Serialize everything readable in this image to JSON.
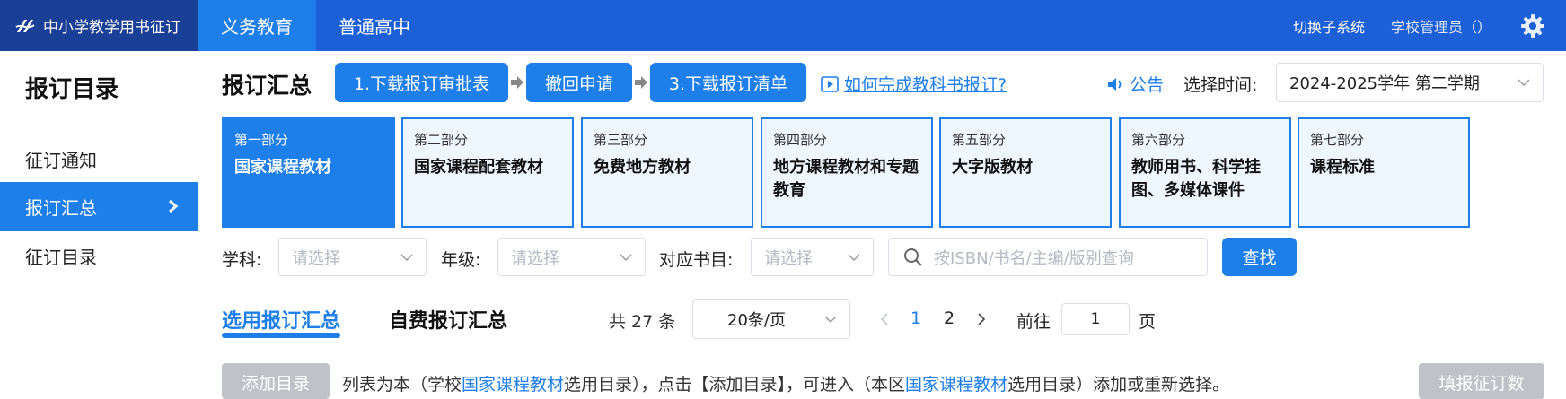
{
  "app": {
    "title": "中小学教学用书征订"
  },
  "nav": {
    "tabs": [
      {
        "label": "义务教育"
      },
      {
        "label": "普通高中"
      }
    ]
  },
  "topbar": {
    "switch_label": "切换子系统",
    "user_label": "学校管理员（）"
  },
  "sidebar": {
    "title": "报订目录",
    "items": [
      {
        "label": "征订通知"
      },
      {
        "label": "报订汇总"
      },
      {
        "label": "征订目录"
      }
    ]
  },
  "header": {
    "title": "报订汇总",
    "steps": [
      {
        "label": "1.下载报订审批表"
      },
      {
        "label": "撤回申请"
      },
      {
        "label": "3.下载报订清单"
      }
    ],
    "help_link": "如何完成教科书报订?",
    "notice": "公告",
    "time_label": "选择时间:",
    "time_value": "2024-2025学年 第二学期"
  },
  "parts": [
    {
      "no": "第一部分",
      "name": "国家课程教材"
    },
    {
      "no": "第二部分",
      "name": "国家课程配套教材"
    },
    {
      "no": "第三部分",
      "name": "免费地方教材"
    },
    {
      "no": "第四部分",
      "name": "地方课程教材和专题教育"
    },
    {
      "no": "第五部分",
      "name": "大字版教材"
    },
    {
      "no": "第六部分",
      "name": "教师用书、科学挂图、多媒体课件"
    },
    {
      "no": "第七部分",
      "name": "课程标准"
    }
  ],
  "filters": {
    "subject_label": "学科:",
    "subject_placeholder": "请选择",
    "grade_label": "年级:",
    "grade_placeholder": "请选择",
    "catalog_label": "对应书目:",
    "catalog_placeholder": "请选择",
    "search_placeholder": "按ISBN/书名/主编/版别查询",
    "search_button": "查找"
  },
  "subtabs": [
    {
      "label": "选用报订汇总"
    },
    {
      "label": "自费报订汇总"
    }
  ],
  "pagination": {
    "total": "共 27 条",
    "page_size": "20条/页",
    "pages": [
      "1",
      "2"
    ],
    "goto_label": "前往",
    "goto_value": "1",
    "page_suffix": "页"
  },
  "bottom": {
    "add_button": "添加目录",
    "note_prefix": "列表为本（学校",
    "note_link1": "国家课程教材",
    "note_mid": "选用目录），点击【添加目录】，可进入（本区",
    "note_link2": "国家课程教材",
    "note_suffix": "选用目录）添加或重新选择。",
    "right_button": "填报征订数"
  },
  "colors": {
    "primary": "#1e7fea",
    "topbar": "#1c5fd6",
    "logo_bg": "#1a3f96",
    "card_bg": "#eef6ff",
    "disabled": "#bfc2c7"
  }
}
